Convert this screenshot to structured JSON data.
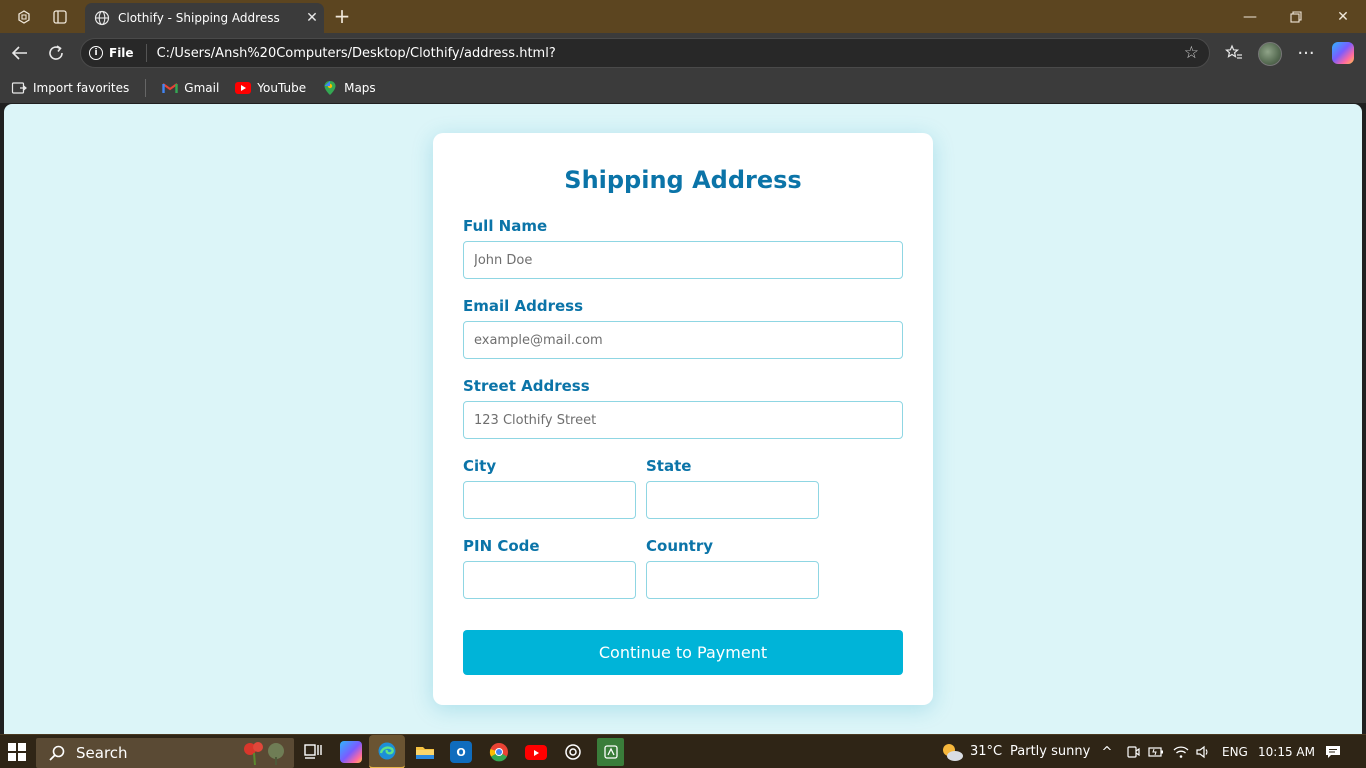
{
  "browser": {
    "tab_title": "Clothify - Shipping Address",
    "url_label": "File",
    "url": "C:/Users/Ansh%20Computers/Desktop/Clothify/address.html?",
    "favorites": [
      {
        "label": "Import favorites",
        "icon": "import-favorites-icon"
      },
      {
        "label": "Gmail",
        "icon": "gmail-icon"
      },
      {
        "label": "YouTube",
        "icon": "youtube-icon"
      },
      {
        "label": "Maps",
        "icon": "maps-icon"
      }
    ]
  },
  "form": {
    "title": "Shipping Address",
    "full_name": {
      "label": "Full Name",
      "placeholder": "John Doe",
      "value": ""
    },
    "email": {
      "label": "Email Address",
      "placeholder": "example@mail.com",
      "value": ""
    },
    "street": {
      "label": "Street Address",
      "placeholder": "123 Clothify Street",
      "value": ""
    },
    "city": {
      "label": "City",
      "placeholder": "",
      "value": ""
    },
    "state": {
      "label": "State",
      "placeholder": "",
      "value": ""
    },
    "pin": {
      "label": "PIN Code",
      "placeholder": "",
      "value": ""
    },
    "country": {
      "label": "Country",
      "placeholder": "",
      "value": ""
    },
    "submit_label": "Continue to Payment"
  },
  "taskbar": {
    "search_label": "Search",
    "weather_temp": "31°C",
    "weather_text": "Partly sunny",
    "language": "ENG",
    "time": "10:15 AM",
    "apps": [
      "task-view-icon",
      "copilot-app-icon",
      "edge-icon",
      "file-explorer-icon",
      "outlook-icon",
      "chrome-icon",
      "youtube-app-icon",
      "chatgpt-icon",
      "whatsapp-icon"
    ]
  },
  "colors": {
    "accent": "#0b74a8",
    "button": "#00b4d8",
    "page_background": "#dcf5f8",
    "input_border": "#8fd6e3"
  }
}
